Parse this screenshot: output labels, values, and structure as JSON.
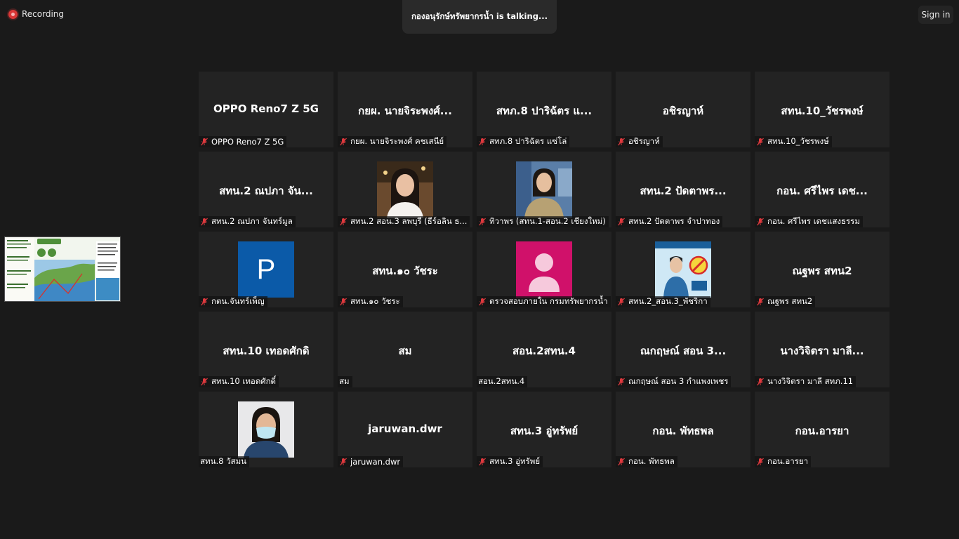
{
  "topbar": {
    "recording_label": "Recording",
    "talking_text": "กองอนุรักษ์ทรัพยากรน้ำ is  talking...",
    "sign_in_label": "Sign in"
  },
  "colors": {
    "background": "#1a1a1a",
    "tile": "#232323",
    "recording_red": "#d93636",
    "muted_red": "#e0393e",
    "avatar_blue": "#0b5aa8",
    "avatar_pink": "#d0116a"
  },
  "participants": [
    {
      "display": "OPPO Reno7 Z 5G",
      "label": "OPPO Reno7 Z 5G",
      "muted": true,
      "video": "none"
    },
    {
      "display": "กยผ. นายจิระพงศ์...",
      "label": "กยผ. นายจิระพงศ์ คชเสนีย์",
      "muted": true,
      "video": "none"
    },
    {
      "display": "สทภ.8 ปาริฉัตร แ...",
      "label": "สทภ.8 ปาริฉัตร แซ่โล่",
      "muted": true,
      "video": "none"
    },
    {
      "display": "อชิรญาห์",
      "label": "อชิรญาห์",
      "muted": true,
      "video": "none"
    },
    {
      "display": "สทน.10_วัชรพงษ์",
      "label": "สทน.10_วัชรพงษ์",
      "muted": true,
      "video": "none"
    },
    {
      "display": "สทน.2 ณปภา จัน...",
      "label": "สทน.2 ณปภา จันทร์มูล",
      "muted": true,
      "video": "none"
    },
    {
      "display": "",
      "label": "สทน.2 สอน.3 ลพบุรี (ธีร์อลิน ธ...",
      "muted": true,
      "video": "woman-long-hair"
    },
    {
      "display": "",
      "label": "ทิวาพร (สทน.1-สอน.2 เชียงใหม่)",
      "muted": true,
      "video": "woman-uniform"
    },
    {
      "display": "สทน.2  ปัดตาพร...",
      "label": "สทน.2  ปัดตาพร จำปาทอง",
      "muted": true,
      "video": "none"
    },
    {
      "display": "กอน. ศรีไพร เดช...",
      "label": "กอน. ศรีไพร เดชแสงธรรม",
      "muted": true,
      "video": "none"
    },
    {
      "display": "",
      "label": "กตน.จันทร์เพ็ญ",
      "muted": true,
      "video": "avatar-letter",
      "avatar_letter": "P"
    },
    {
      "display": "สทน.๑๐ วัชระ",
      "label": "สทน.๑๐ วัชระ",
      "muted": true,
      "video": "none"
    },
    {
      "display": "",
      "label": "ตรวจสอบภายใน กรมทรัพยากรน้ำ",
      "muted": true,
      "video": "avatar-person"
    },
    {
      "display": "",
      "label": "สทน.2_สอน.3_พัชริกา",
      "muted": true,
      "video": "poster"
    },
    {
      "display": "ณฐพร สทน2",
      "label": "ณฐพร สทน2",
      "muted": true,
      "video": "none"
    },
    {
      "display": "สทน.10 เทอดศักดิ",
      "label": "สทน.10 เทอดศักดิ์",
      "muted": true,
      "video": "none"
    },
    {
      "display": "สม",
      "label": "สม",
      "muted": false,
      "video": "none"
    },
    {
      "display": "สอน.2สทน.4",
      "label": "สอน.2สทน.4",
      "muted": false,
      "video": "none"
    },
    {
      "display": "ณกฤษณ์ สอน 3...",
      "label": "ณกฤษณ์ สอน 3 กำแพงเพชร",
      "muted": true,
      "video": "none"
    },
    {
      "display": "นางวิจิตรา  มาลี...",
      "label": "นางวิจิตรา  มาลี  สทภ.11",
      "muted": true,
      "video": "none"
    },
    {
      "display": "",
      "label": "สทน.8 วัสมน",
      "muted": false,
      "video": "woman-mask"
    },
    {
      "display": "jaruwan.dwr",
      "label": "jaruwan.dwr",
      "muted": true,
      "video": "none"
    },
    {
      "display": "สทน.3  อู่ทรัพย์",
      "label": "สทน.3  อู่ทรัพย์",
      "muted": true,
      "video": "none"
    },
    {
      "display": "กอน. พัทธพล",
      "label": "กอน. พัทธพล",
      "muted": true,
      "video": "none"
    },
    {
      "display": "กอน.อารยา",
      "label": "กอน.อารยา",
      "muted": true,
      "video": "none"
    }
  ]
}
